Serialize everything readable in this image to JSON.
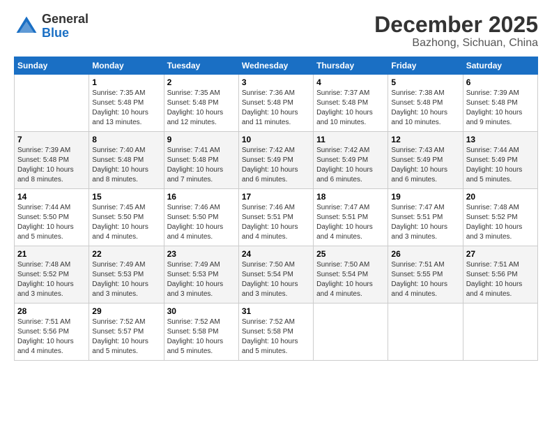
{
  "header": {
    "logo_general": "General",
    "logo_blue": "Blue",
    "month": "December 2025",
    "location": "Bazhong, Sichuan, China"
  },
  "columns": [
    "Sunday",
    "Monday",
    "Tuesday",
    "Wednesday",
    "Thursday",
    "Friday",
    "Saturday"
  ],
  "weeks": [
    [
      {
        "day": "",
        "sunrise": "",
        "sunset": "",
        "daylight": ""
      },
      {
        "day": "1",
        "sunrise": "Sunrise: 7:35 AM",
        "sunset": "Sunset: 5:48 PM",
        "daylight": "Daylight: 10 hours and 13 minutes."
      },
      {
        "day": "2",
        "sunrise": "Sunrise: 7:35 AM",
        "sunset": "Sunset: 5:48 PM",
        "daylight": "Daylight: 10 hours and 12 minutes."
      },
      {
        "day": "3",
        "sunrise": "Sunrise: 7:36 AM",
        "sunset": "Sunset: 5:48 PM",
        "daylight": "Daylight: 10 hours and 11 minutes."
      },
      {
        "day": "4",
        "sunrise": "Sunrise: 7:37 AM",
        "sunset": "Sunset: 5:48 PM",
        "daylight": "Daylight: 10 hours and 10 minutes."
      },
      {
        "day": "5",
        "sunrise": "Sunrise: 7:38 AM",
        "sunset": "Sunset: 5:48 PM",
        "daylight": "Daylight: 10 hours and 10 minutes."
      },
      {
        "day": "6",
        "sunrise": "Sunrise: 7:39 AM",
        "sunset": "Sunset: 5:48 PM",
        "daylight": "Daylight: 10 hours and 9 minutes."
      }
    ],
    [
      {
        "day": "7",
        "sunrise": "Sunrise: 7:39 AM",
        "sunset": "Sunset: 5:48 PM",
        "daylight": "Daylight: 10 hours and 8 minutes."
      },
      {
        "day": "8",
        "sunrise": "Sunrise: 7:40 AM",
        "sunset": "Sunset: 5:48 PM",
        "daylight": "Daylight: 10 hours and 8 minutes."
      },
      {
        "day": "9",
        "sunrise": "Sunrise: 7:41 AM",
        "sunset": "Sunset: 5:48 PM",
        "daylight": "Daylight: 10 hours and 7 minutes."
      },
      {
        "day": "10",
        "sunrise": "Sunrise: 7:42 AM",
        "sunset": "Sunset: 5:49 PM",
        "daylight": "Daylight: 10 hours and 6 minutes."
      },
      {
        "day": "11",
        "sunrise": "Sunrise: 7:42 AM",
        "sunset": "Sunset: 5:49 PM",
        "daylight": "Daylight: 10 hours and 6 minutes."
      },
      {
        "day": "12",
        "sunrise": "Sunrise: 7:43 AM",
        "sunset": "Sunset: 5:49 PM",
        "daylight": "Daylight: 10 hours and 6 minutes."
      },
      {
        "day": "13",
        "sunrise": "Sunrise: 7:44 AM",
        "sunset": "Sunset: 5:49 PM",
        "daylight": "Daylight: 10 hours and 5 minutes."
      }
    ],
    [
      {
        "day": "14",
        "sunrise": "Sunrise: 7:44 AM",
        "sunset": "Sunset: 5:50 PM",
        "daylight": "Daylight: 10 hours and 5 minutes."
      },
      {
        "day": "15",
        "sunrise": "Sunrise: 7:45 AM",
        "sunset": "Sunset: 5:50 PM",
        "daylight": "Daylight: 10 hours and 4 minutes."
      },
      {
        "day": "16",
        "sunrise": "Sunrise: 7:46 AM",
        "sunset": "Sunset: 5:50 PM",
        "daylight": "Daylight: 10 hours and 4 minutes."
      },
      {
        "day": "17",
        "sunrise": "Sunrise: 7:46 AM",
        "sunset": "Sunset: 5:51 PM",
        "daylight": "Daylight: 10 hours and 4 minutes."
      },
      {
        "day": "18",
        "sunrise": "Sunrise: 7:47 AM",
        "sunset": "Sunset: 5:51 PM",
        "daylight": "Daylight: 10 hours and 4 minutes."
      },
      {
        "day": "19",
        "sunrise": "Sunrise: 7:47 AM",
        "sunset": "Sunset: 5:51 PM",
        "daylight": "Daylight: 10 hours and 3 minutes."
      },
      {
        "day": "20",
        "sunrise": "Sunrise: 7:48 AM",
        "sunset": "Sunset: 5:52 PM",
        "daylight": "Daylight: 10 hours and 3 minutes."
      }
    ],
    [
      {
        "day": "21",
        "sunrise": "Sunrise: 7:48 AM",
        "sunset": "Sunset: 5:52 PM",
        "daylight": "Daylight: 10 hours and 3 minutes."
      },
      {
        "day": "22",
        "sunrise": "Sunrise: 7:49 AM",
        "sunset": "Sunset: 5:53 PM",
        "daylight": "Daylight: 10 hours and 3 minutes."
      },
      {
        "day": "23",
        "sunrise": "Sunrise: 7:49 AM",
        "sunset": "Sunset: 5:53 PM",
        "daylight": "Daylight: 10 hours and 3 minutes."
      },
      {
        "day": "24",
        "sunrise": "Sunrise: 7:50 AM",
        "sunset": "Sunset: 5:54 PM",
        "daylight": "Daylight: 10 hours and 3 minutes."
      },
      {
        "day": "25",
        "sunrise": "Sunrise: 7:50 AM",
        "sunset": "Sunset: 5:54 PM",
        "daylight": "Daylight: 10 hours and 4 minutes."
      },
      {
        "day": "26",
        "sunrise": "Sunrise: 7:51 AM",
        "sunset": "Sunset: 5:55 PM",
        "daylight": "Daylight: 10 hours and 4 minutes."
      },
      {
        "day": "27",
        "sunrise": "Sunrise: 7:51 AM",
        "sunset": "Sunset: 5:56 PM",
        "daylight": "Daylight: 10 hours and 4 minutes."
      }
    ],
    [
      {
        "day": "28",
        "sunrise": "Sunrise: 7:51 AM",
        "sunset": "Sunset: 5:56 PM",
        "daylight": "Daylight: 10 hours and 4 minutes."
      },
      {
        "day": "29",
        "sunrise": "Sunrise: 7:52 AM",
        "sunset": "Sunset: 5:57 PM",
        "daylight": "Daylight: 10 hours and 5 minutes."
      },
      {
        "day": "30",
        "sunrise": "Sunrise: 7:52 AM",
        "sunset": "Sunset: 5:58 PM",
        "daylight": "Daylight: 10 hours and 5 minutes."
      },
      {
        "day": "31",
        "sunrise": "Sunrise: 7:52 AM",
        "sunset": "Sunset: 5:58 PM",
        "daylight": "Daylight: 10 hours and 5 minutes."
      },
      {
        "day": "",
        "sunrise": "",
        "sunset": "",
        "daylight": ""
      },
      {
        "day": "",
        "sunrise": "",
        "sunset": "",
        "daylight": ""
      },
      {
        "day": "",
        "sunrise": "",
        "sunset": "",
        "daylight": ""
      }
    ]
  ]
}
